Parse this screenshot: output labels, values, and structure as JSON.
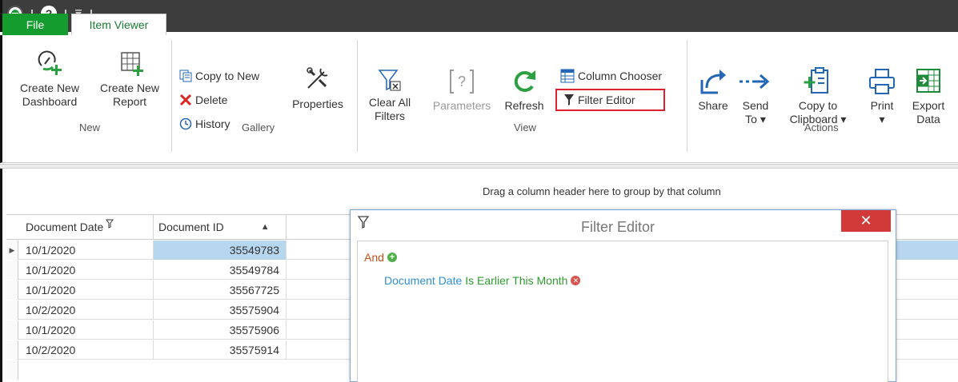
{
  "qat": {
    "app_logo": "app-logo-icon",
    "help": "?"
  },
  "tabs": {
    "file": "File",
    "item_viewer": "Item Viewer"
  },
  "ribbon": {
    "new_group": {
      "label": "New",
      "create_dashboard_line1": "Create New",
      "create_dashboard_line2": "Dashboard",
      "create_report_line1": "Create New",
      "create_report_line2": "Report"
    },
    "gallery_group": {
      "label": "Gallery",
      "copy_to_new": "Copy to New",
      "delete": "Delete",
      "history": "History",
      "properties": "Properties"
    },
    "view_group": {
      "label": "View",
      "clear_all_filters_line1": "Clear All",
      "clear_all_filters_line2": "Filters",
      "parameters": "Parameters",
      "refresh": "Refresh",
      "column_chooser": "Column Chooser",
      "filter_editor": "Filter Editor"
    },
    "actions_group": {
      "label": "Actions",
      "share": "Share",
      "send_line1": "Send",
      "send_line2": "To",
      "copy_line1": "Copy to",
      "copy_line2": "Clipboard",
      "print": "Print",
      "export_line1": "Export",
      "export_line2": "Data"
    }
  },
  "groupby_hint": "Drag a column header here to group by that column",
  "grid": {
    "columns": [
      "Document Date",
      "Document ID"
    ],
    "rows": [
      {
        "date": "10/1/2020",
        "id": "35549783"
      },
      {
        "date": "10/1/2020",
        "id": "35549784"
      },
      {
        "date": "10/1/2020",
        "id": "35567725"
      },
      {
        "date": "10/2/2020",
        "id": "35575904"
      },
      {
        "date": "10/1/2020",
        "id": "35575906"
      },
      {
        "date": "10/2/2020",
        "id": "35575914"
      }
    ]
  },
  "filter_editor": {
    "title": "Filter Editor",
    "close": "✕",
    "group_operator": "And",
    "condition_field": "Document Date",
    "condition_operator": "Is Earlier This Month"
  },
  "colors": {
    "accent_green": "#159c2e",
    "highlight_red": "#e0202e",
    "selection_blue": "#b7d7ef"
  }
}
